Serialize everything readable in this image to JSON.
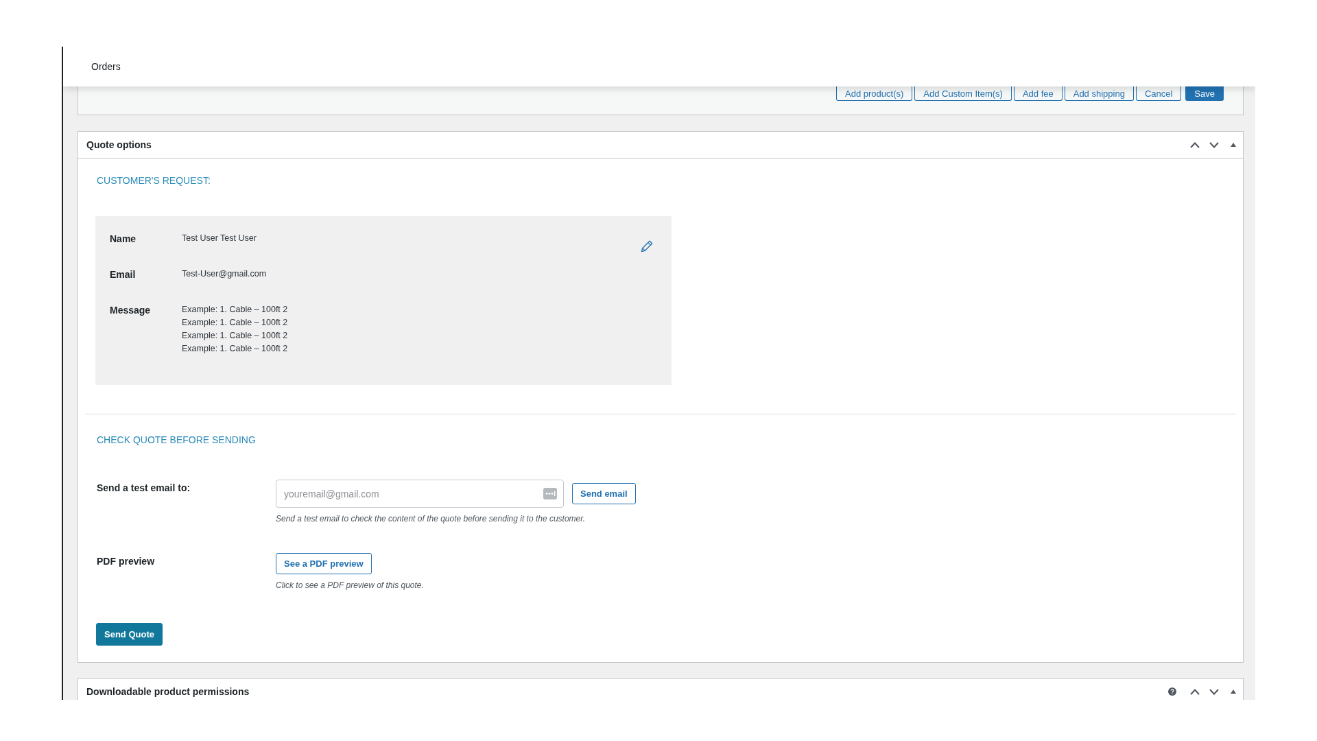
{
  "header": {
    "title": "Orders"
  },
  "order_items": {
    "buttons": [
      {
        "label": "Add product(s)",
        "kind": "secondary"
      },
      {
        "label": "Add Custom Item(s)",
        "kind": "secondary"
      },
      {
        "label": "Add fee",
        "kind": "secondary"
      },
      {
        "label": "Add shipping",
        "kind": "secondary"
      },
      {
        "label": "Cancel",
        "kind": "secondary"
      },
      {
        "label": "Save",
        "kind": "primary"
      }
    ]
  },
  "quote_options": {
    "title": "Quote options",
    "customer_request": {
      "heading": "CUSTOMER'S REQUEST:",
      "fields": [
        {
          "label": "Name",
          "lines": [
            "Test User Test User"
          ]
        },
        {
          "label": "Email",
          "lines": [
            "Test-User@gmail.com"
          ]
        },
        {
          "label": "Message",
          "lines": [
            "Example: 1. Cable – 100ft 2",
            "Example: 1. Cable – 100ft 2",
            "Example: 1. Cable – 100ft 2",
            "Example: 1. Cable – 100ft 2"
          ]
        }
      ]
    },
    "check_quote": {
      "heading": "CHECK QUOTE BEFORE SENDING",
      "rows": [
        {
          "kind": "email",
          "label": "Send a test email to:",
          "placeholder": "youremail@gmail.com",
          "button": "Send email",
          "help": "Send a test email to check the content of the quote before sending it to the customer."
        },
        {
          "kind": "pdf",
          "label": "PDF preview",
          "button": "See a PDF preview",
          "help": "Click to see a PDF preview of this quote."
        }
      ]
    },
    "send_button": "Send Quote"
  },
  "downloadable_permissions": {
    "title": "Downloadable product permissions"
  }
}
